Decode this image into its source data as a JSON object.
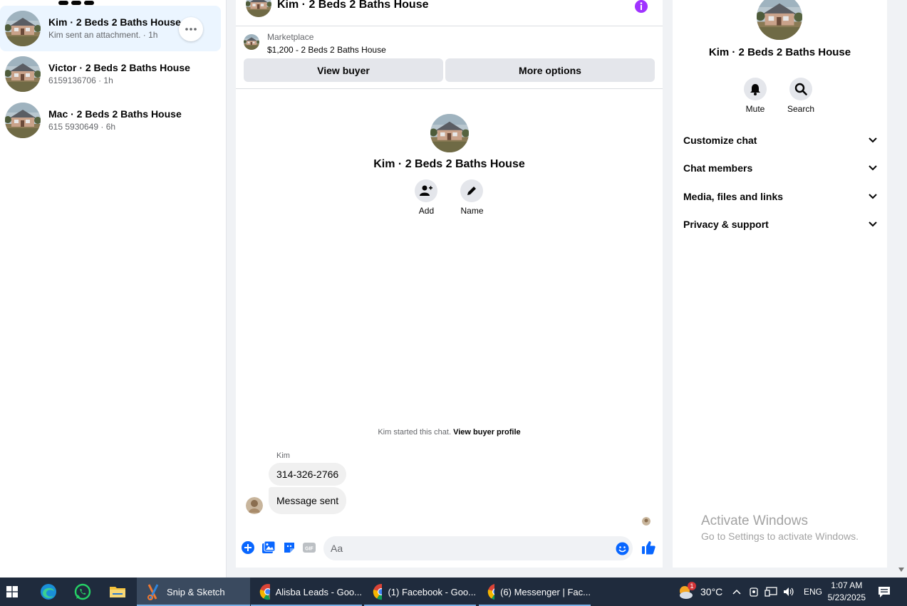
{
  "chat_list": {
    "items": [
      {
        "title": "Kim · 2 Beds 2 Baths House",
        "subtitle": "Kim sent an attachment. · 1h"
      },
      {
        "title": "Victor · 2 Beds 2 Baths House",
        "subtitle": "6159136706 · 1h"
      },
      {
        "title": "Mac · 2 Beds 2 Baths House",
        "subtitle": "615 5930649 · 6h"
      }
    ]
  },
  "conversation": {
    "title": "Kim · 2 Beds 2 Baths House",
    "marketplace_label": "Marketplace",
    "listing": "$1,200 - 2 Beds 2 Baths House",
    "view_buyer": "View buyer",
    "more_options": "More options",
    "profile_name": "Kim · 2 Beds 2 Baths House",
    "add_label": "Add",
    "name_label": "Name",
    "started_text": "Kim started this chat.",
    "view_buyer_profile": "View buyer profile",
    "sender": "Kim",
    "messages": [
      "314-326-2766",
      "Message sent"
    ],
    "composer_placeholder": "Aa"
  },
  "details": {
    "title": "Kim · 2 Beds 2 Baths House",
    "mute_label": "Mute",
    "search_label": "Search",
    "sections": [
      "Customize chat",
      "Chat members",
      "Media, files and links",
      "Privacy & support"
    ]
  },
  "watermark": {
    "line1": "Activate Windows",
    "line2": "Go to Settings to activate Windows."
  },
  "taskbar": {
    "apps": [
      {
        "label": "Snip & Sketch"
      },
      {
        "label": "Alisba Leads - Goo..."
      },
      {
        "label": "(1) Facebook - Goo..."
      },
      {
        "label": "(6) Messenger | Fac..."
      }
    ],
    "weather_badge": "1",
    "temperature": "30°C",
    "language": "ENG",
    "time": "1:07 AM",
    "date": "5/23/2025"
  },
  "colors": {
    "messenger_blue": "#0866ff",
    "info_purple": "#a033ff",
    "active_row": "#ebf5ff",
    "taskbar": "#1f2b3d"
  }
}
